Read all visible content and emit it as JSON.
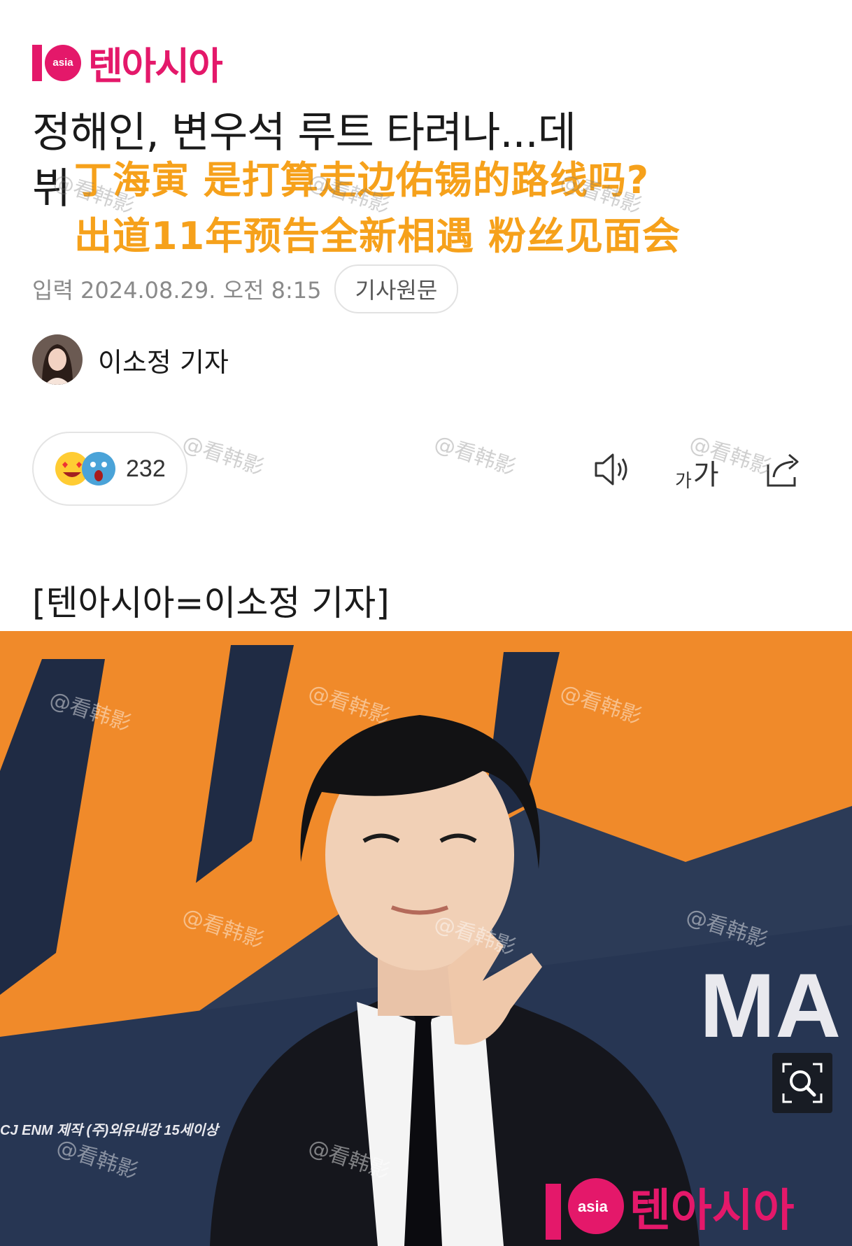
{
  "brand": {
    "logo_number": "1",
    "logo_badge": "asia",
    "logo_text": "텐아시아"
  },
  "article": {
    "headline_line1": "정해인, 변우석 루트 타려나...데",
    "headline_line2": "뷔",
    "overlay_line1": "丁海寅 是打算走边佑锡的路线吗?",
    "overlay_line2": "出道11年预告全新相遇 粉丝见面会",
    "date": "입력 2024.08.29. 오전 8:15",
    "source_button": "기사원문",
    "author": "이소정 기자",
    "byline": "[텐아시아=이소정 기자]"
  },
  "reactions": {
    "count": "232",
    "icons": [
      "heart-eyes-emoji",
      "shocked-emoji"
    ]
  },
  "toolbar": {
    "font_small": "가",
    "font_big": "가",
    "icons": [
      "speaker-icon",
      "font-size-icon",
      "share-icon"
    ]
  },
  "photo": {
    "backdrop_text": "MA",
    "caption_small": "CJ ENM  제작 (주)외유내강  15세이상",
    "logo_text": "텐아시아",
    "logo_badge": "asia"
  },
  "watermark": "@看韩影",
  "colors": {
    "brand": "#e4186a",
    "overlay": "#f6a11b",
    "backdrop_orange": "#f08a2a",
    "backdrop_navy": "#2c3b57"
  }
}
